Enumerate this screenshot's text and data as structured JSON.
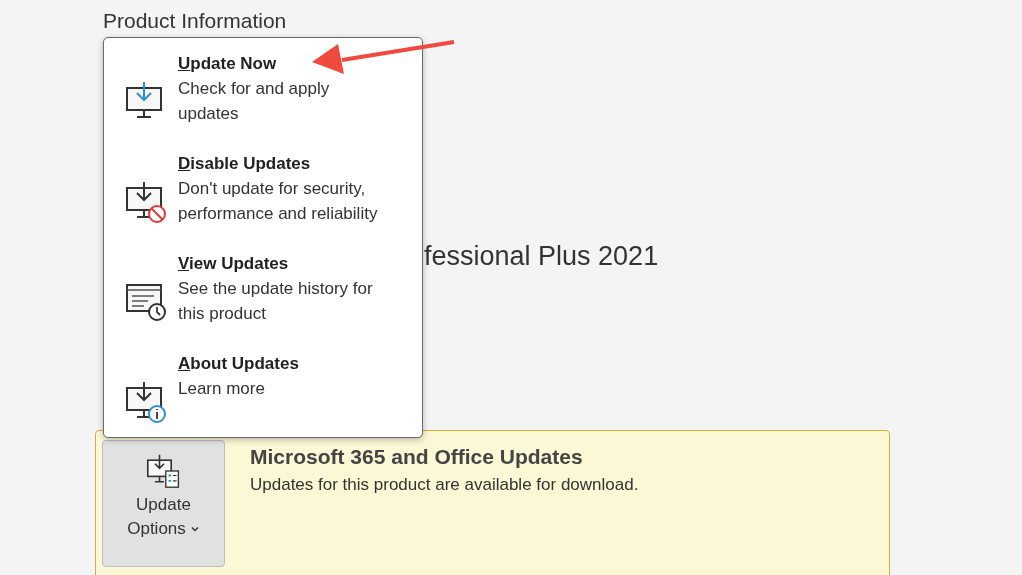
{
  "heading": "Product Information",
  "product_name": "fessional Plus 2021",
  "update_menu": {
    "items": [
      {
        "kind": "update",
        "title": "Update Now",
        "description_lines": [
          "Check for and apply",
          "updates"
        ]
      },
      {
        "kind": "disable",
        "title": "Disable Updates",
        "description_lines": [
          "Don't update for security,",
          "performance and reliability"
        ]
      },
      {
        "kind": "view",
        "title": "View Updates",
        "description_lines": [
          "See the update history for",
          "this product"
        ]
      },
      {
        "kind": "about",
        "title": "About Updates",
        "description_lines": [
          "Learn more"
        ]
      }
    ]
  },
  "updates_card": {
    "button": {
      "label_lines": [
        "Update",
        "Options"
      ],
      "expanded": true
    },
    "title": "Microsoft 365 and Office Updates",
    "description": "Updates for this product are available for download."
  }
}
